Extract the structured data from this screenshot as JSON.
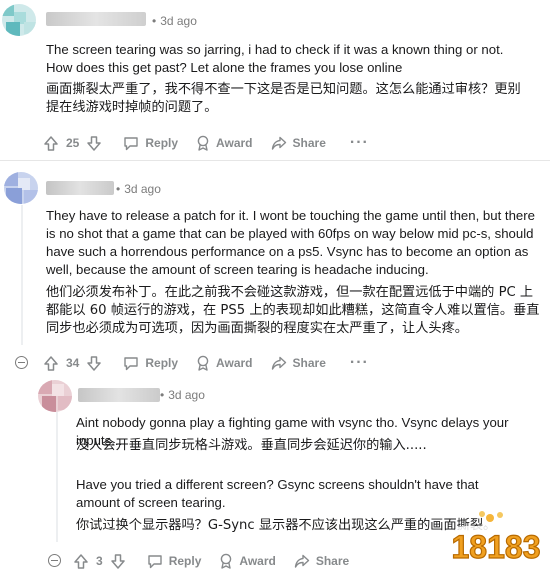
{
  "comments": [
    {
      "time": "3d ago",
      "text_en": "The screen tearing was so jarring, i had to check if it was a known thing or not. How does this get past? Let alone the frames you lose online",
      "text_zh": "画面撕裂太严重了，我不得不查一下这是否是已知问题。这怎么能通过审核？更别提在线游戏时掉帧的问题了。",
      "score": "25",
      "reply": "Reply",
      "award": "Award",
      "share": "Share",
      "more": "···"
    },
    {
      "time": "3d ago",
      "text_en": "They have to release a patch for it. I wont be touching the game until then, but there is no shot that a game that can be played with 60fps on way below mid pc-s, should have such a horrendous performance on a ps5. Vsync has to become an option as well, because the amount of screen tearing is headache inducing.",
      "text_zh": "他们必须发布补丁。在此之前我不会碰这款游戏，但一款在配置远低于中端的 PC 上都能以 60 帧运行的游戏，在 PS5 上的表现却如此糟糕，这简直令人难以置信。垂直同步也必须成为可选项，因为画面撕裂的程度实在太严重了，让人头疼。",
      "score": "34",
      "reply": "Reply",
      "award": "Award",
      "share": "Share",
      "more": "···"
    },
    {
      "time": "3d ago",
      "text_en1": "Aint nobody gonna play a fighting game with vsync tho. Vsync delays your inputs...",
      "text_zh1": "没人会开垂直同步玩格斗游戏。垂直同步会延迟你的输入.....",
      "text_en2": "Have you tried a different screen? Gsync screens shouldn't have that amount of screen tearing.",
      "text_zh2": "你试过换个显示器吗？G-Sync 显示器不应该出现这么严重的画面撕裂。",
      "score": "3",
      "reply": "Reply",
      "award": "Award",
      "share": "Share"
    }
  ],
  "watermark": {
    "text": "18183"
  },
  "colors": {
    "text": "#1a1a1b",
    "meta": "#7c7c7c",
    "action": "#878a8c",
    "watermark": "#f0a020"
  }
}
